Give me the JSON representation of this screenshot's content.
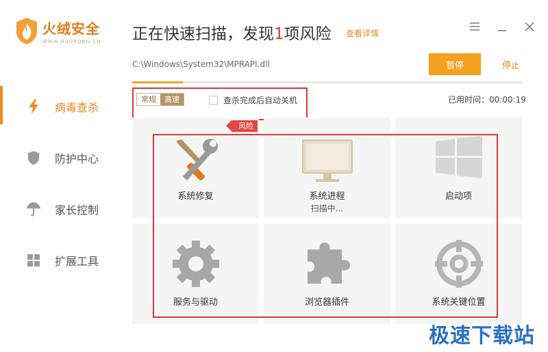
{
  "app": {
    "name": "火绒安全",
    "subtitle": "WWW.HUORONG.CN",
    "accent": "#f5a01e",
    "danger": "#d9363e"
  },
  "sidebar": {
    "items": [
      {
        "label": "病毒查杀",
        "icon": "lightning-icon",
        "active": true
      },
      {
        "label": "防护中心",
        "icon": "shield-icon",
        "active": false
      },
      {
        "label": "家长控制",
        "icon": "umbrella-icon",
        "active": false
      },
      {
        "label": "扩展工具",
        "icon": "grid-tiles-icon",
        "active": false
      }
    ]
  },
  "header": {
    "title_prefix": "正在快速扫描，发现",
    "title_count": "1",
    "title_suffix": "项风险",
    "details_link": "查看详情"
  },
  "scan": {
    "current_path": "C:\\Windows\\System32\\MPRAPI.dll",
    "pause_label": "暂停",
    "stop_label": "停止",
    "progress": 0.13,
    "mode_normal": "常规",
    "mode_fast": "高速",
    "auto_shutdown_label": "查杀完成后自动关机",
    "auto_shutdown_checked": false,
    "elapsed_label": "已用时间：00:00:19",
    "risk_tag": "风险"
  },
  "categories": [
    {
      "label": "系统修复",
      "icon": "wrench-screwdriver-icon",
      "status": ""
    },
    {
      "label": "系统进程",
      "icon": "monitor-icon",
      "status": "扫描中..."
    },
    {
      "label": "启动项",
      "icon": "windows-logo-icon",
      "status": ""
    },
    {
      "label": "服务与驱动",
      "icon": "gear-icon",
      "status": ""
    },
    {
      "label": "浏览器插件",
      "icon": "puzzle-icon",
      "status": ""
    },
    {
      "label": "系统关键位置",
      "icon": "crosshair-icon",
      "status": ""
    }
  ],
  "watermark": "极速下载站"
}
